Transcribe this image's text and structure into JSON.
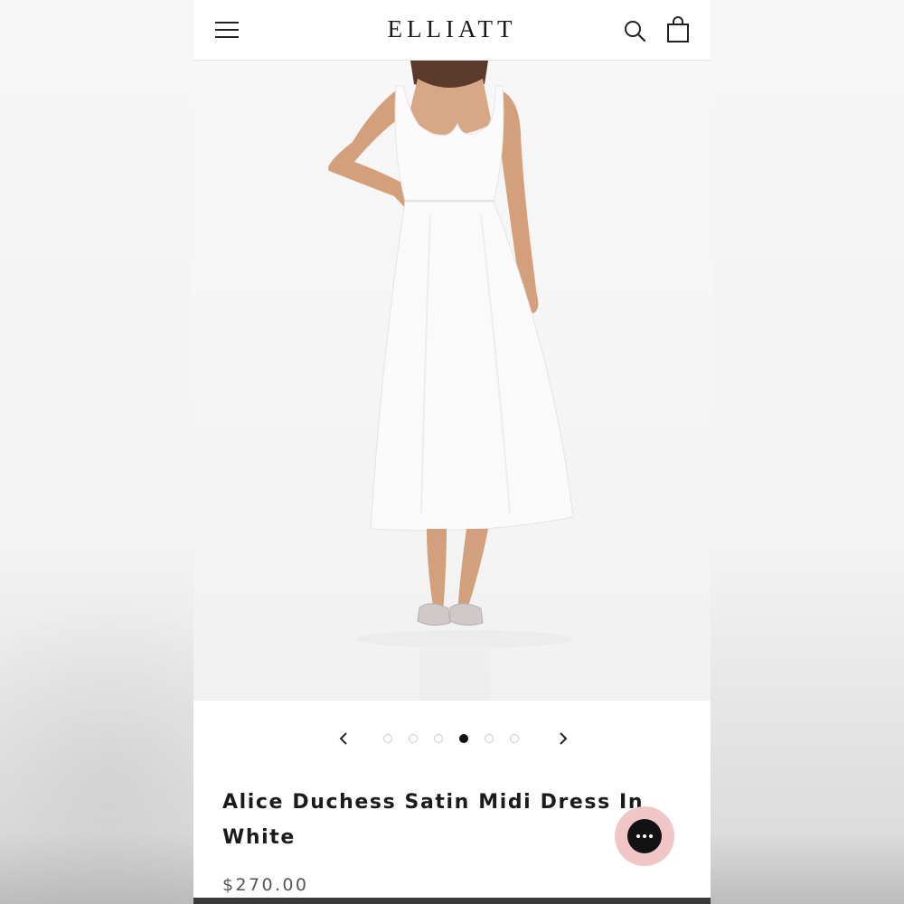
{
  "header": {
    "brand": "ELLIATT",
    "menu_icon": "hamburger-menu-icon",
    "search_icon": "search-icon",
    "cart_icon": "shopping-bag-icon"
  },
  "gallery": {
    "image_alt": "Alice Duchess Satin Midi Dress In White",
    "slide_count": 6,
    "active_index": 3,
    "prev_icon": "chevron-left-icon",
    "next_icon": "chevron-right-icon"
  },
  "product": {
    "title": "Alice Duchess Satin Midi Dress In White",
    "price": "$270.00"
  },
  "chat": {
    "icon": "chat-bubble-icon",
    "accent": "#f1c6c6"
  }
}
